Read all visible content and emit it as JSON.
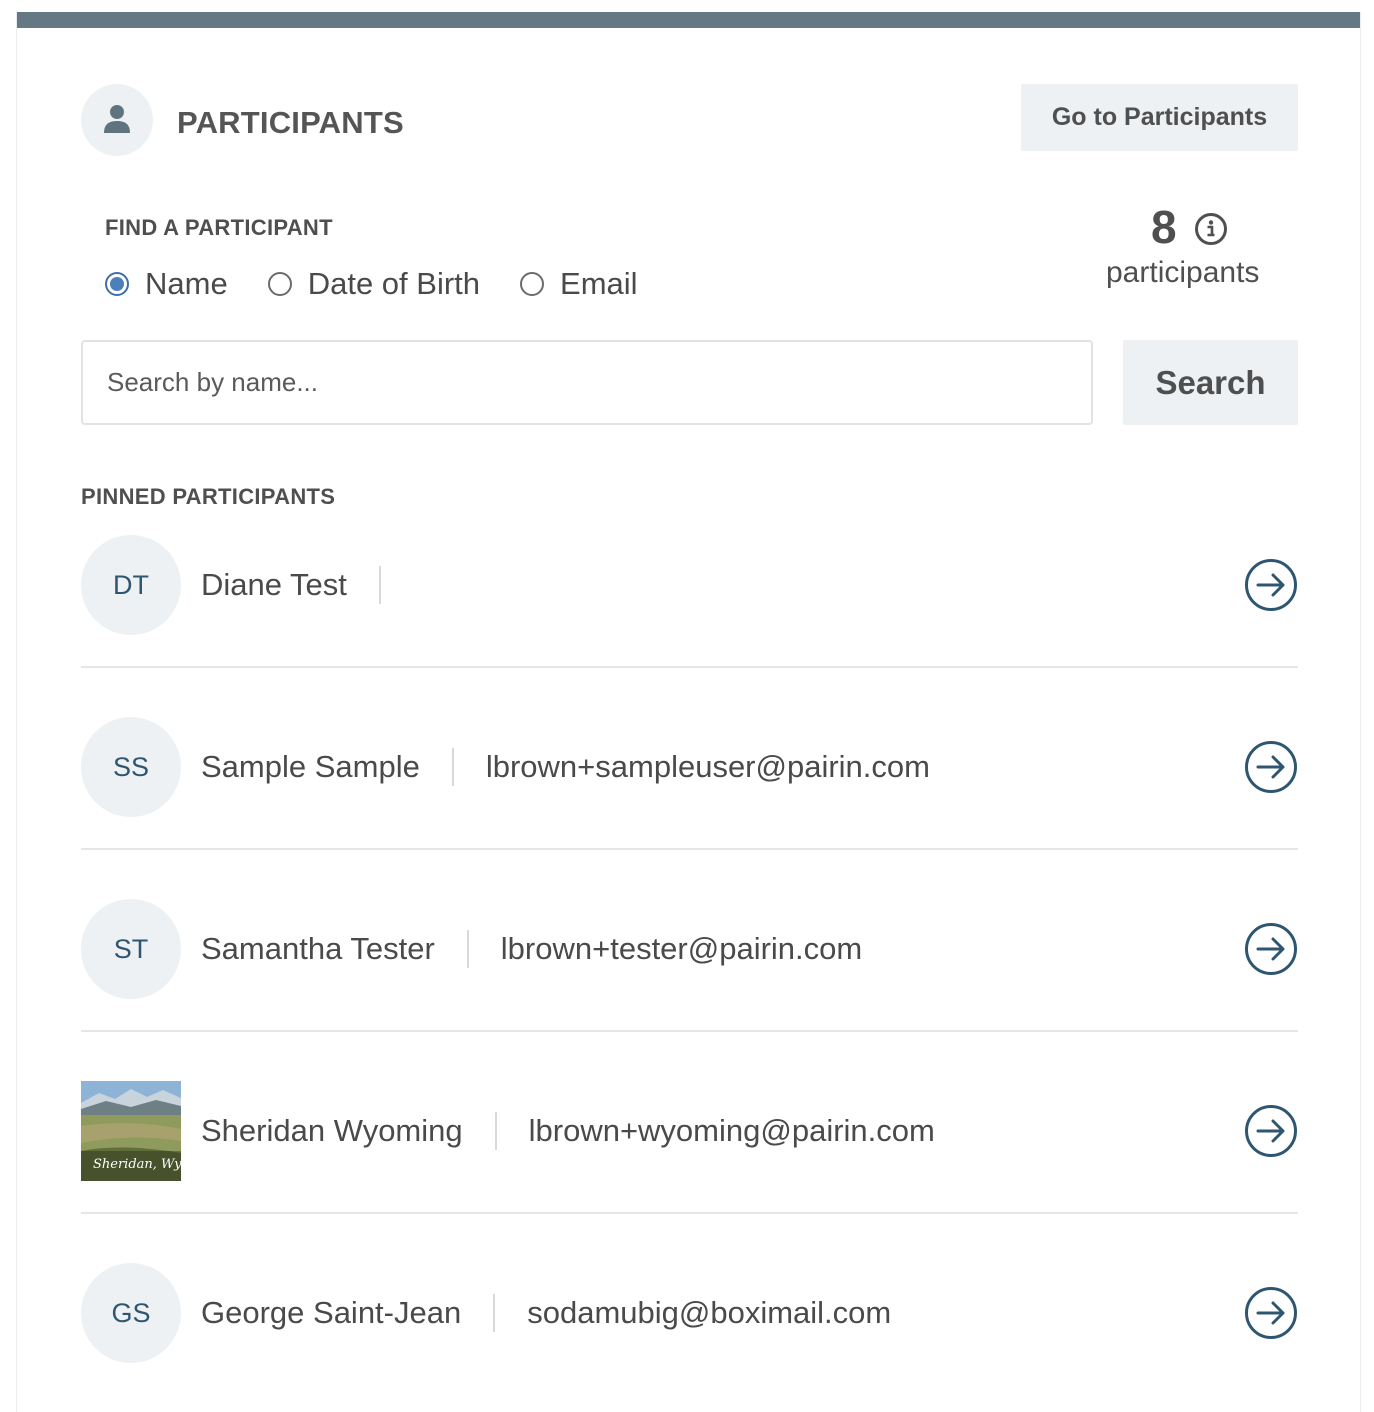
{
  "header": {
    "title": "PARTICIPANTS",
    "goto_label": "Go to Participants",
    "icon": "person-icon"
  },
  "find": {
    "label": "FIND A PARTICIPANT",
    "options": [
      {
        "label": "Name",
        "checked": true
      },
      {
        "label": "Date of Birth",
        "checked": false
      },
      {
        "label": "Email",
        "checked": false
      }
    ],
    "search_placeholder": "Search by name...",
    "search_label": "Search"
  },
  "count": {
    "value": "8",
    "label": "participants",
    "icon": "info-icon"
  },
  "pinned": {
    "label": "PINNED PARTICIPANTS",
    "items": [
      {
        "initials": "DT",
        "name": "Diane Test",
        "email": "",
        "photo": false
      },
      {
        "initials": "SS",
        "name": "Sample Sample",
        "email": "lbrown+sampleuser@pairin.com",
        "photo": false
      },
      {
        "initials": "ST",
        "name": "Samantha Tester",
        "email": "lbrown+tester@pairin.com",
        "photo": false
      },
      {
        "initials": "",
        "name": "Sheridan Wyoming",
        "email": "lbrown+wyoming@pairin.com",
        "photo": true,
        "photo_caption": "Sheridan, Wyo"
      },
      {
        "initials": "GS",
        "name": "George Saint-Jean",
        "email": "sodamubig@boximail.com",
        "photo": false
      }
    ]
  },
  "colors": {
    "top_bar": "#647983",
    "chip_bg": "#edf1f4",
    "accent": "#2f5670",
    "radio_selected": "#4d7fba"
  }
}
